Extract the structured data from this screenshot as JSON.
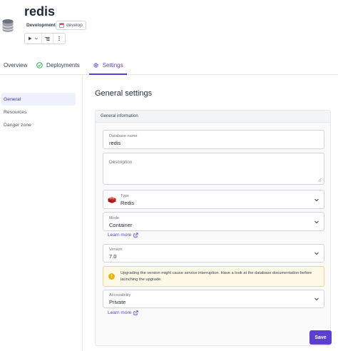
{
  "header": {
    "title": "redis",
    "environment": "Development",
    "branch": "develop",
    "db_icon": "database-icon",
    "actions": {
      "play_icon": "play-icon",
      "dropdown_icon": "chevron-down-icon",
      "logs_icon": "logs-icon",
      "more_icon": "more-vertical-icon"
    }
  },
  "tabs": [
    {
      "label": "Overview",
      "icon": ""
    },
    {
      "label": "Deployments",
      "icon": "check-circle-icon"
    },
    {
      "label": "Settings",
      "icon": "gear-icon",
      "active": true
    }
  ],
  "leftnav": {
    "items": [
      {
        "label": "General",
        "active": true
      },
      {
        "label": "Resources"
      },
      {
        "label": "Danger zone"
      }
    ]
  },
  "main": {
    "title": "General settings",
    "panel_title": "General information",
    "database_name": {
      "label": "Database name",
      "value": "redis"
    },
    "description": {
      "label": "Description",
      "value": ""
    },
    "type": {
      "label": "Type",
      "value": "Redis",
      "icon": "redis-icon"
    },
    "mode": {
      "label": "Mode",
      "value": "Container"
    },
    "learn_more_1": "Learn more",
    "version": {
      "label": "Version",
      "value": "7.0"
    },
    "warning": "Upgrading the version might cause service interruption. Have a look at the database documentation before launching the upgrade.",
    "accessibility": {
      "label": "Accessibility",
      "value": "Private"
    },
    "learn_more_2": "Learn more",
    "save_label": "Save"
  },
  "colors": {
    "accent": "#5b3fd1",
    "warning_bg": "#fef9e7",
    "warning_border": "#f5d58a",
    "success": "#16a34a"
  }
}
